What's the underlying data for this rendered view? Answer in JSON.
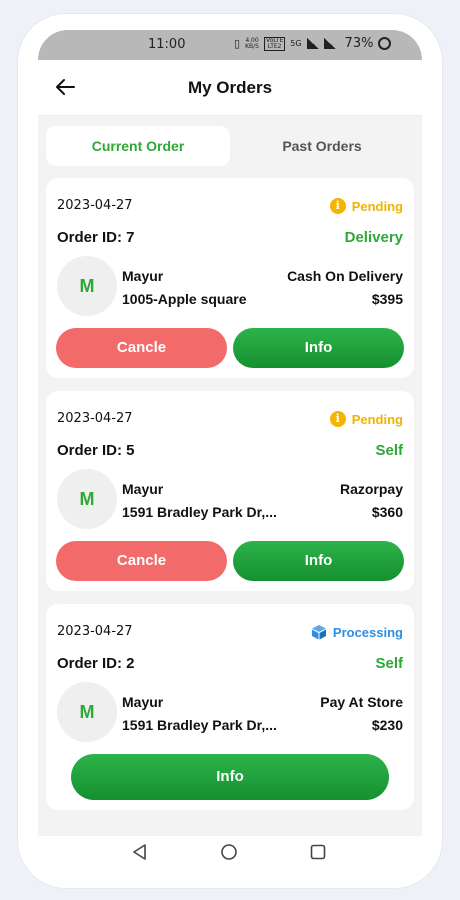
{
  "status_bar": {
    "time": "11:00",
    "data_speed_value": "4.00",
    "data_speed_unit": "KB/S",
    "network_label_top": "VoLTE",
    "network_label_bottom": "LTE2",
    "network_gen": "5G",
    "battery": "73%"
  },
  "app_bar": {
    "title": "My Orders",
    "back_icon": "arrow-left-icon"
  },
  "tabs": [
    {
      "label": "Current Order",
      "active": true
    },
    {
      "label": "Past Orders",
      "active": false
    }
  ],
  "orders": [
    {
      "date": "2023-04-27",
      "status": "Pending",
      "status_icon": "info-icon",
      "order_id": "Order ID: 7",
      "type": "Delivery",
      "avatar_letter": "M",
      "customer": "Mayur",
      "address": "1005-Apple square",
      "payment": "Cash On Delivery",
      "amount": "$395",
      "cancel_label": "Cancle",
      "info_label": "Info"
    },
    {
      "date": "2023-04-27",
      "status": "Pending",
      "status_icon": "info-icon",
      "order_id": "Order ID: 5",
      "type": "Self",
      "avatar_letter": "M",
      "customer": "Mayur",
      "address": "1591 Bradley Park Dr,...",
      "payment": "Razorpay",
      "amount": "$360",
      "cancel_label": "Cancle",
      "info_label": "Info"
    },
    {
      "date": "2023-04-27",
      "status": "Processing",
      "status_icon": "box-icon",
      "order_id": "Order ID: 2",
      "type": "Self",
      "avatar_letter": "M",
      "customer": "Mayur",
      "address": "1591 Bradley Park Dr,...",
      "payment": "Pay At Store",
      "amount": "$230",
      "info_label": "Info"
    }
  ],
  "colors": {
    "accent_green": "#2ea836",
    "pending": "#f2b300",
    "processing": "#2e8fe0",
    "cancel": "#f26a6a"
  },
  "nav_bar": {
    "icons": [
      "back-triangle-icon",
      "home-circle-icon",
      "recents-square-icon"
    ]
  }
}
